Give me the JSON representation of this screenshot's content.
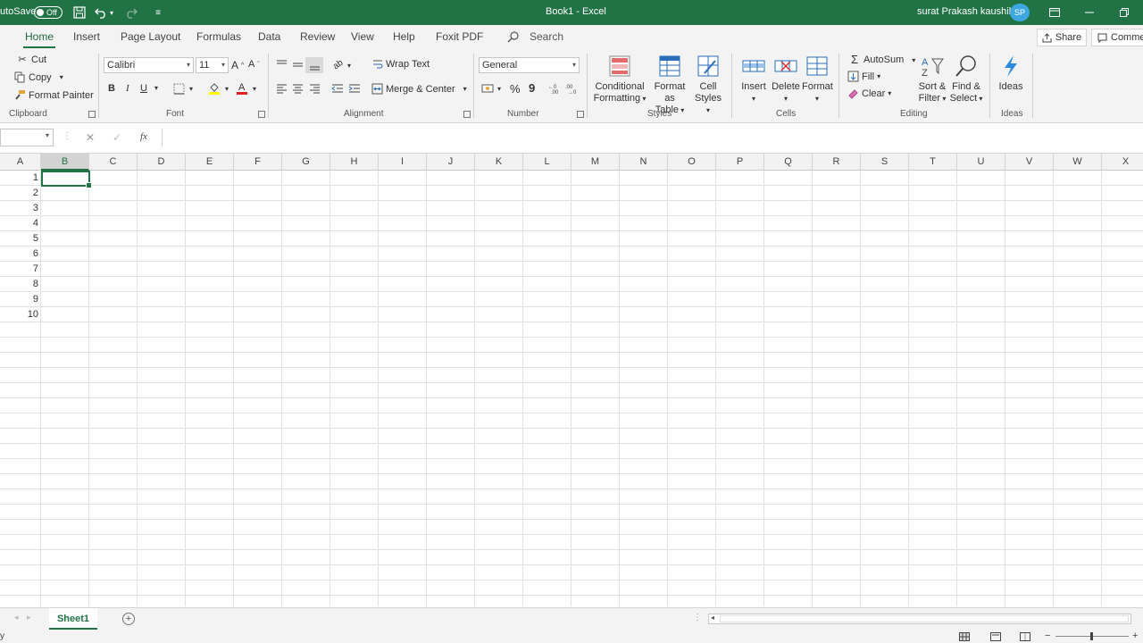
{
  "titlebar": {
    "autosave_label": "utoSave",
    "autosave_state": "Off",
    "doc_title": "Book1  -  Excel",
    "user_name": "surat Prakash kaushik",
    "user_initials": "SP"
  },
  "tabs": [
    "Home",
    "Insert",
    "Page Layout",
    "Formulas",
    "Data",
    "Review",
    "View",
    "Help",
    "Foxit PDF"
  ],
  "search_label": "Search",
  "share_label": "Share",
  "comments_label": "Comme",
  "clipboard": {
    "cut": "Cut",
    "copy": "Copy",
    "format_painter": "Format Painter",
    "label": "Clipboard"
  },
  "font": {
    "name": "Calibri",
    "size": "11",
    "bold": "B",
    "italic": "I",
    "underline": "U",
    "label": "Font"
  },
  "alignment": {
    "wrap_text": "Wrap Text",
    "merge_center": "Merge & Center",
    "label": "Alignment"
  },
  "number": {
    "format": "General",
    "percent": "%",
    "comma": "9",
    "label": "Number"
  },
  "styles": {
    "cond_1": "Conditional",
    "cond_2": "Formatting",
    "table_1": "Format as",
    "table_2": "Table",
    "cell_1": "Cell",
    "cell_2": "Styles",
    "label": "Styles"
  },
  "cells": {
    "insert": "Insert",
    "delete": "Delete",
    "format": "Format",
    "label": "Cells"
  },
  "editing": {
    "autosum": "AutoSum",
    "fill": "Fill",
    "clear": "Clear",
    "sort_1": "Sort &",
    "sort_2": "Filter",
    "find_1": "Find &",
    "find_2": "Select",
    "label": "Editing"
  },
  "ideas": {
    "button": "Ideas",
    "label": "Ideas"
  },
  "formula_bar": {
    "cancel": "✕",
    "enter": "✓",
    "fx": "fx"
  },
  "columns": [
    "A",
    "B",
    "C",
    "D",
    "E",
    "F",
    "G",
    "H",
    "I",
    "J",
    "K",
    "L",
    "M",
    "N",
    "O",
    "P",
    "Q",
    "R",
    "S",
    "T",
    "U",
    "V",
    "W",
    "X"
  ],
  "rows": [
    "1",
    "2",
    "3",
    "4",
    "5",
    "6",
    "7",
    "8",
    "9",
    "10"
  ],
  "sheets": [
    "Sheet1"
  ],
  "status": {
    "left": "y"
  }
}
